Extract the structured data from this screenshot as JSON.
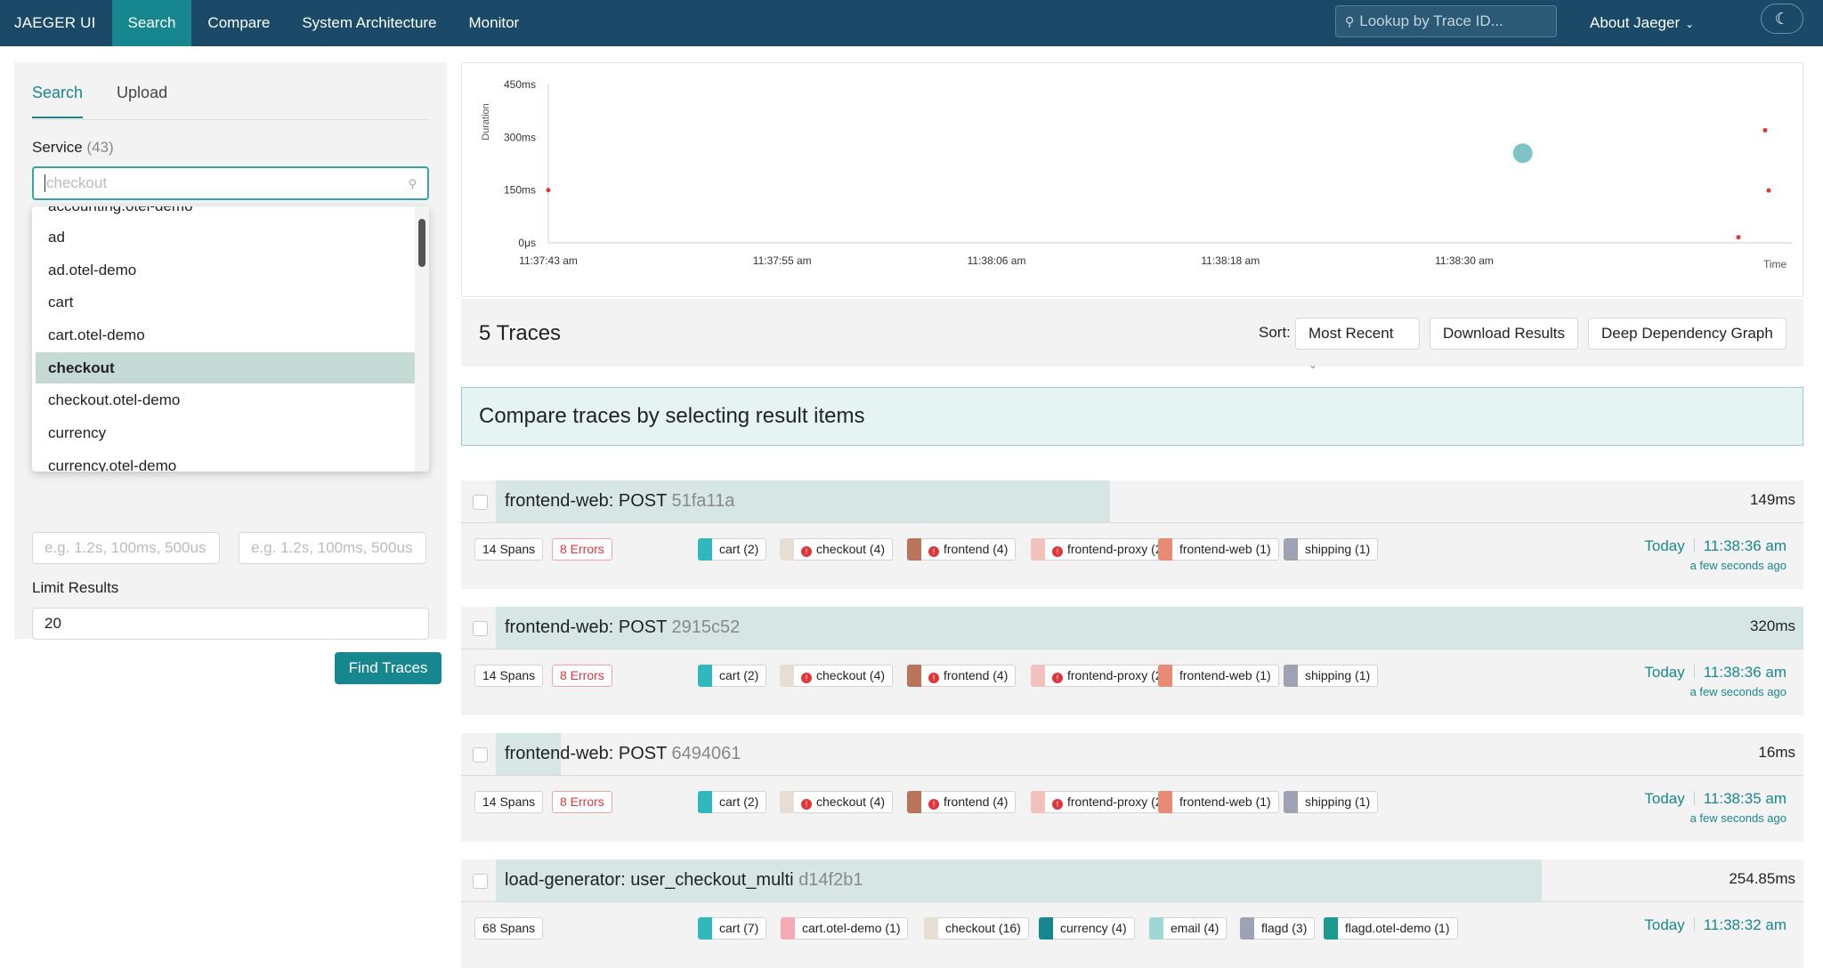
{
  "nav": {
    "brand": "JAEGER UI",
    "items": [
      "Search",
      "Compare",
      "System Architecture",
      "Monitor"
    ],
    "lookup_placeholder": "Lookup by Trace ID...",
    "about": "About Jaeger"
  },
  "left": {
    "tabs": [
      "Search",
      "Upload"
    ],
    "service_label": "Service",
    "service_count": "(43)",
    "service_placeholder": "checkout",
    "dropdown": [
      "accounting.otel-demo",
      "ad",
      "ad.otel-demo",
      "cart",
      "cart.otel-demo",
      "checkout",
      "checkout.otel-demo",
      "currency",
      "currency.otel-demo"
    ],
    "selected": "checkout",
    "dur_placeholder": "e.g. 1.2s, 100ms, 500us",
    "limit_label": "Limit Results",
    "limit_value": "20",
    "find_button": "Find Traces"
  },
  "chart_data": {
    "type": "scatter",
    "ylabel": "Duration",
    "xlabel": "Time",
    "y_ticks": [
      "0μs",
      "150ms",
      "300ms",
      "450ms"
    ],
    "x_ticks": [
      "11:37:43 am",
      "11:37:55 am",
      "11:38:06 am",
      "11:38:18 am",
      "11:38:30 am"
    ],
    "points": [
      {
        "x": "11:37:43 am",
        "y": 150,
        "size": "small",
        "color": "#e0363b"
      },
      {
        "x": "11:38:33 am",
        "y": 254.85,
        "size": "large",
        "color": "#68b8bb"
      },
      {
        "x": "11:38:36 am",
        "y": 16,
        "size": "small",
        "color": "#e0363b"
      },
      {
        "x": "11:38:36 am",
        "y": 320,
        "size": "small",
        "color": "#e0363b"
      },
      {
        "x": "11:38:36 am",
        "y": 149,
        "size": "small",
        "color": "#e0363b"
      }
    ]
  },
  "results": {
    "count": "5 Traces",
    "sort_label": "Sort:",
    "sort_value": "Most Recent",
    "download": "Download Results",
    "ddg": "Deep Dependency Graph",
    "compare_banner": "Compare traces by selecting result items"
  },
  "traces": [
    {
      "title": "frontend-web: POST",
      "id": "51fa11a",
      "duration": "149ms",
      "bar_fraction": 0.47,
      "spans": "14 Spans",
      "errors": "8 Errors",
      "day": "Today",
      "time": "11:38:36 am",
      "ago": "a few seconds ago",
      "services": [
        {
          "name": "cart (2)",
          "color": "#2fb9be",
          "err": false
        },
        {
          "name": "checkout (4)",
          "color": "#e6ddd3",
          "err": true
        },
        {
          "name": "frontend (4)",
          "color": "#b9745a",
          "err": true
        },
        {
          "name": "frontend-proxy (2)",
          "color": "#f2c0bd",
          "err": true
        },
        {
          "name": "frontend-web (1)",
          "color": "#e98a74",
          "err": false
        },
        {
          "name": "shipping (1)",
          "color": "#9ea3b4",
          "err": false
        }
      ]
    },
    {
      "title": "frontend-web: POST",
      "id": "2915c52",
      "duration": "320ms",
      "bar_fraction": 1.0,
      "spans": "14 Spans",
      "errors": "8 Errors",
      "day": "Today",
      "time": "11:38:36 am",
      "ago": "a few seconds ago",
      "services": [
        {
          "name": "cart (2)",
          "color": "#2fb9be",
          "err": false
        },
        {
          "name": "checkout (4)",
          "color": "#e6ddd3",
          "err": true
        },
        {
          "name": "frontend (4)",
          "color": "#b9745a",
          "err": true
        },
        {
          "name": "frontend-proxy (2)",
          "color": "#f2c0bd",
          "err": true
        },
        {
          "name": "frontend-web (1)",
          "color": "#e98a74",
          "err": false
        },
        {
          "name": "shipping (1)",
          "color": "#9ea3b4",
          "err": false
        }
      ]
    },
    {
      "title": "frontend-web: POST",
      "id": "6494061",
      "duration": "16ms",
      "bar_fraction": 0.05,
      "spans": "14 Spans",
      "errors": "8 Errors",
      "day": "Today",
      "time": "11:38:35 am",
      "ago": "a few seconds ago",
      "services": [
        {
          "name": "cart (2)",
          "color": "#2fb9be",
          "err": false
        },
        {
          "name": "checkout (4)",
          "color": "#e6ddd3",
          "err": true
        },
        {
          "name": "frontend (4)",
          "color": "#b9745a",
          "err": true
        },
        {
          "name": "frontend-proxy (2)",
          "color": "#f2c0bd",
          "err": true
        },
        {
          "name": "frontend-web (1)",
          "color": "#e98a74",
          "err": false
        },
        {
          "name": "shipping (1)",
          "color": "#9ea3b4",
          "err": false
        }
      ]
    },
    {
      "title": "load-generator: user_checkout_multi",
      "id": "d14f2b1",
      "duration": "254.85ms",
      "bar_fraction": 0.8,
      "spans": "68 Spans",
      "errors": "",
      "day": "Today",
      "time": "11:38:32 am",
      "ago": "",
      "services": [
        {
          "name": "cart (7)",
          "color": "#2fb9be",
          "err": false
        },
        {
          "name": "cart.otel-demo (1)",
          "color": "#f5a9b4",
          "err": false
        },
        {
          "name": "checkout (16)",
          "color": "#e6ddd3",
          "err": false
        },
        {
          "name": "currency (4)",
          "color": "#17878f",
          "err": false
        },
        {
          "name": "email (4)",
          "color": "#9fd6d6",
          "err": false
        },
        {
          "name": "flagd (3)",
          "color": "#9ea3b4",
          "err": false
        },
        {
          "name": "flagd.otel-demo (1)",
          "color": "#1a9a8f",
          "err": false
        }
      ]
    }
  ]
}
